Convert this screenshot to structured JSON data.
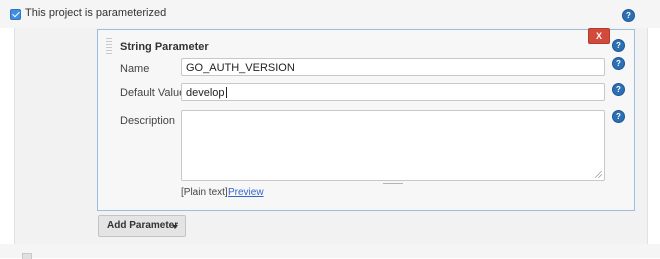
{
  "parameterized": {
    "checked": true,
    "label": "This project is parameterized",
    "help_icon": "?"
  },
  "string_parameter": {
    "title": "String Parameter",
    "delete_label": "X",
    "help_icon": "?",
    "name_label": "Name",
    "name_value": "GO_AUTH_VERSION",
    "default_label": "Default Value",
    "default_value": "develop",
    "description_label": "Description",
    "description_value": "",
    "plain_text_label": "[Plain text]",
    "preview_link": "Preview"
  },
  "add_parameter": {
    "label": "Add Parameter",
    "icon": "caret-down-icon"
  },
  "colors": {
    "accent": "#2d6fb5",
    "delete": "#d24a3b",
    "link": "#3366cc"
  }
}
